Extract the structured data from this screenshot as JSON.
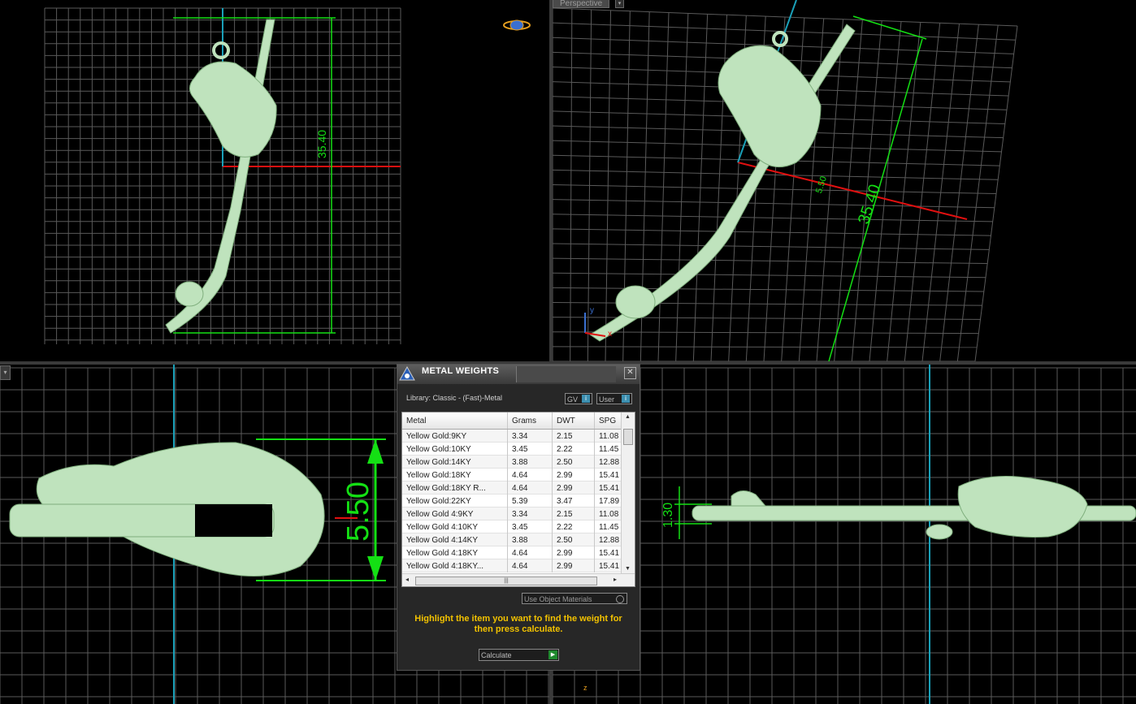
{
  "viewports": {
    "top_left": {
      "dimension_label": "35.40"
    },
    "top_right": {
      "tab_label": "Perspective",
      "dimension_label_main": "35.40",
      "dimension_label_small": "5.50",
      "axis_x": "x",
      "axis_y": "y"
    },
    "bottom_left": {
      "dimension_label": "5.50"
    },
    "bottom_right": {
      "dimension_label": "1.30",
      "axis_z": "z"
    }
  },
  "dialog": {
    "title": "METAL WEIGHTS",
    "library": "Library: Classic - (Fast)-Metal",
    "gv_label": "GV",
    "user_label": "User",
    "columns": [
      "Metal",
      "Grams",
      "DWT",
      "SPG"
    ],
    "rows": [
      [
        "Yellow Gold:9KY",
        "3.34",
        "2.15",
        "11.08"
      ],
      [
        "Yellow Gold:10KY",
        "3.45",
        "2.22",
        "11.45"
      ],
      [
        "Yellow Gold:14KY",
        "3.88",
        "2.50",
        "12.88"
      ],
      [
        "Yellow Gold:18KY",
        "4.64",
        "2.99",
        "15.41"
      ],
      [
        "Yellow Gold:18KY R...",
        "4.64",
        "2.99",
        "15.41"
      ],
      [
        "Yellow Gold:22KY",
        "5.39",
        "3.47",
        "17.89"
      ],
      [
        "Yellow Gold 4:9KY",
        "3.34",
        "2.15",
        "11.08"
      ],
      [
        "Yellow Gold 4:10KY",
        "3.45",
        "2.22",
        "11.45"
      ],
      [
        "Yellow Gold 4:14KY",
        "3.88",
        "2.50",
        "12.88"
      ],
      [
        "Yellow Gold 4:18KY",
        "4.64",
        "2.99",
        "15.41"
      ],
      [
        "Yellow Gold 4:18KY...",
        "4.64",
        "2.99",
        "15.41"
      ]
    ],
    "use_object_materials": "Use Object Materials",
    "hint": "Highlight the item you want to find the weight for then press calculate.",
    "calculate_label": "Calculate"
  },
  "colors": {
    "model": "#bfe3bd",
    "grid": "#5a5a5a",
    "dimension": "#14e014",
    "axis_red": "#e01010",
    "axis_cyan": "#1aa0b8",
    "hint": "#f2c200"
  }
}
